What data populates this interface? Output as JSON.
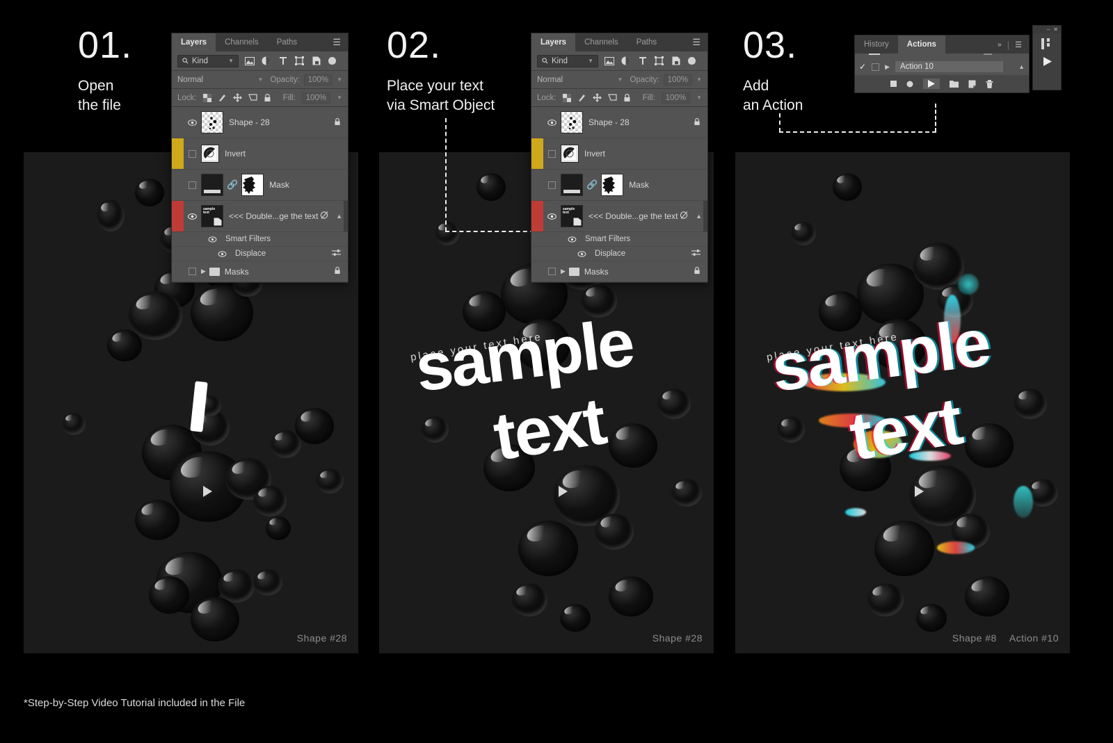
{
  "page": {
    "background": "#000000",
    "footnote": "*Step-by-Step Video Tutorial included in the File"
  },
  "steps": [
    {
      "number": "01.",
      "description": "Open\nthe file",
      "caption_primary": "Shape #28",
      "caption_secondary": ""
    },
    {
      "number": "02.",
      "description": "Place your text\nvia Smart Object",
      "caption_primary": "Shape #28",
      "caption_secondary": ""
    },
    {
      "number": "03.",
      "description": "Add\nan Action",
      "caption_primary": "Shape #8",
      "caption_secondary": "Action #10"
    }
  ],
  "artwork": {
    "arc_text": "place your text here",
    "word_1": "sample",
    "word_2": "text"
  },
  "layers_panel": {
    "tabs": [
      {
        "label": "Layers",
        "active": true
      },
      {
        "label": "Channels",
        "active": false
      },
      {
        "label": "Paths",
        "active": false
      }
    ],
    "menu_icon": "hamburger-menu-icon",
    "filter": {
      "search_icon": "search-icon",
      "kind_label": "Kind",
      "chevron": "chevron-down-icon",
      "icons": [
        "image-filter-icon",
        "adjustment-filter-icon",
        "type-filter-icon",
        "shape-filter-icon",
        "smart-object-filter-icon"
      ],
      "toggle_icon": "filter-toggle-icon"
    },
    "blend": {
      "mode": "Normal",
      "opacity_label": "Opacity:",
      "opacity_value": "100%"
    },
    "lock": {
      "label": "Lock:",
      "icons": [
        "lock-transparency-icon",
        "lock-image-icon",
        "lock-position-icon",
        "lock-artboard-icon",
        "lock-all-icon"
      ],
      "fill_label": "Fill:",
      "fill_value": "100%"
    },
    "rows": [
      {
        "name": "Shape - 28",
        "swatch": "none",
        "visible": true,
        "locked": true,
        "thumb": "checker-shape-thumb"
      },
      {
        "name": "Invert",
        "swatch": "#d0a81c",
        "visible": false,
        "locked": false,
        "thumb": "invert-adjustment-thumb"
      },
      {
        "name": "Mask",
        "swatch": "none",
        "visible": false,
        "locked": false,
        "thumb": "mask-pair-thumb"
      },
      {
        "name": "<<< Double...ge the text",
        "swatch": "#bf3b35",
        "visible": true,
        "locked": false,
        "thumb": "smart-object-thumb"
      }
    ],
    "sub_rows": [
      {
        "name": "Smart Filters",
        "visible": true,
        "indent": 1
      },
      {
        "name": "Displace",
        "visible": true,
        "indent": 2
      }
    ],
    "group_row": {
      "name": "Masks",
      "locked": true,
      "chevron": "chevron-right-icon"
    }
  },
  "actions_panel": {
    "tabs": [
      {
        "label": "History",
        "active": false
      },
      {
        "label": "Actions",
        "active": true
      }
    ],
    "expand_icon": "double-chevron-right-icon",
    "menu_icon": "hamburger-menu-icon",
    "row": {
      "checked": true,
      "check_icon": "check-icon",
      "chevron": "chevron-right-icon",
      "name": "Action 10"
    },
    "toolbar": [
      "stop-icon",
      "record-icon",
      "play-icon",
      "new-folder-icon",
      "duplicate-icon",
      "delete-icon"
    ]
  },
  "float_window": {
    "minimize_icon": "minimize-icon",
    "close_icon": "close-icon",
    "play_icon": "play-icon"
  },
  "colors": {
    "panel_bg": "#535353",
    "panel_header": "#3a3a3a",
    "art_bg": "#1b1b1b",
    "yellow_swatch": "#d0a81c",
    "red_swatch": "#bf3b35"
  }
}
